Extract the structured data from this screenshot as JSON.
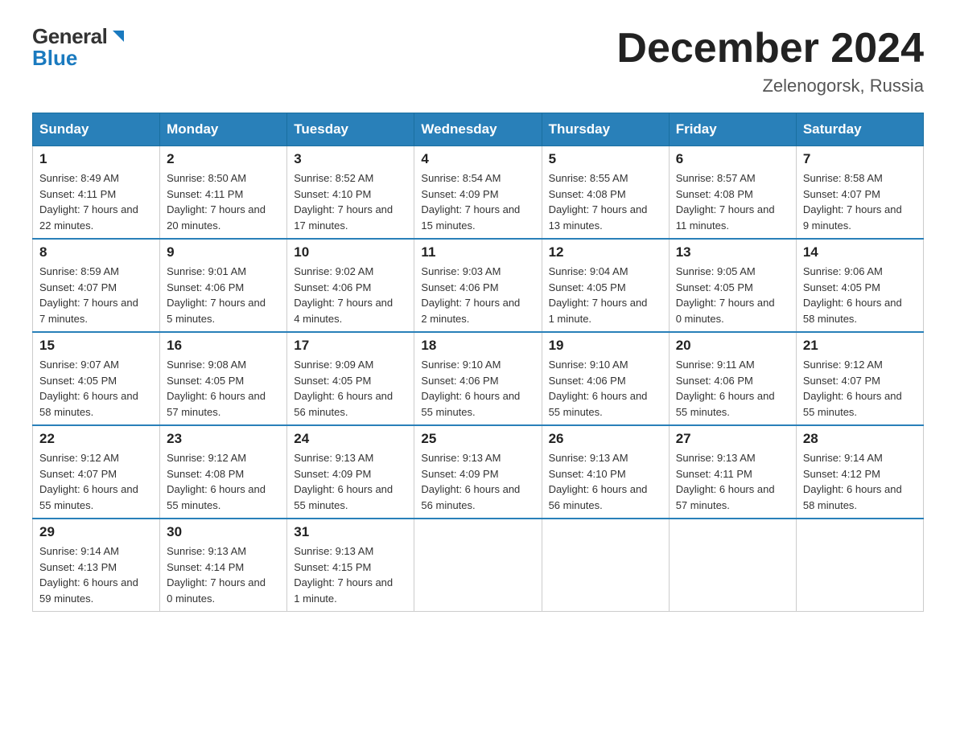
{
  "header": {
    "logo_general": "General",
    "logo_blue": "Blue",
    "title": "December 2024",
    "location": "Zelenogorsk, Russia"
  },
  "days_of_week": [
    "Sunday",
    "Monday",
    "Tuesday",
    "Wednesday",
    "Thursday",
    "Friday",
    "Saturday"
  ],
  "weeks": [
    {
      "days": [
        {
          "number": "1",
          "sunrise": "8:49 AM",
          "sunset": "4:11 PM",
          "daylight": "7 hours and 22 minutes."
        },
        {
          "number": "2",
          "sunrise": "8:50 AM",
          "sunset": "4:11 PM",
          "daylight": "7 hours and 20 minutes."
        },
        {
          "number": "3",
          "sunrise": "8:52 AM",
          "sunset": "4:10 PM",
          "daylight": "7 hours and 17 minutes."
        },
        {
          "number": "4",
          "sunrise": "8:54 AM",
          "sunset": "4:09 PM",
          "daylight": "7 hours and 15 minutes."
        },
        {
          "number": "5",
          "sunrise": "8:55 AM",
          "sunset": "4:08 PM",
          "daylight": "7 hours and 13 minutes."
        },
        {
          "number": "6",
          "sunrise": "8:57 AM",
          "sunset": "4:08 PM",
          "daylight": "7 hours and 11 minutes."
        },
        {
          "number": "7",
          "sunrise": "8:58 AM",
          "sunset": "4:07 PM",
          "daylight": "7 hours and 9 minutes."
        }
      ]
    },
    {
      "days": [
        {
          "number": "8",
          "sunrise": "8:59 AM",
          "sunset": "4:07 PM",
          "daylight": "7 hours and 7 minutes."
        },
        {
          "number": "9",
          "sunrise": "9:01 AM",
          "sunset": "4:06 PM",
          "daylight": "7 hours and 5 minutes."
        },
        {
          "number": "10",
          "sunrise": "9:02 AM",
          "sunset": "4:06 PM",
          "daylight": "7 hours and 4 minutes."
        },
        {
          "number": "11",
          "sunrise": "9:03 AM",
          "sunset": "4:06 PM",
          "daylight": "7 hours and 2 minutes."
        },
        {
          "number": "12",
          "sunrise": "9:04 AM",
          "sunset": "4:05 PM",
          "daylight": "7 hours and 1 minute."
        },
        {
          "number": "13",
          "sunrise": "9:05 AM",
          "sunset": "4:05 PM",
          "daylight": "7 hours and 0 minutes."
        },
        {
          "number": "14",
          "sunrise": "9:06 AM",
          "sunset": "4:05 PM",
          "daylight": "6 hours and 58 minutes."
        }
      ]
    },
    {
      "days": [
        {
          "number": "15",
          "sunrise": "9:07 AM",
          "sunset": "4:05 PM",
          "daylight": "6 hours and 58 minutes."
        },
        {
          "number": "16",
          "sunrise": "9:08 AM",
          "sunset": "4:05 PM",
          "daylight": "6 hours and 57 minutes."
        },
        {
          "number": "17",
          "sunrise": "9:09 AM",
          "sunset": "4:05 PM",
          "daylight": "6 hours and 56 minutes."
        },
        {
          "number": "18",
          "sunrise": "9:10 AM",
          "sunset": "4:06 PM",
          "daylight": "6 hours and 55 minutes."
        },
        {
          "number": "19",
          "sunrise": "9:10 AM",
          "sunset": "4:06 PM",
          "daylight": "6 hours and 55 minutes."
        },
        {
          "number": "20",
          "sunrise": "9:11 AM",
          "sunset": "4:06 PM",
          "daylight": "6 hours and 55 minutes."
        },
        {
          "number": "21",
          "sunrise": "9:12 AM",
          "sunset": "4:07 PM",
          "daylight": "6 hours and 55 minutes."
        }
      ]
    },
    {
      "days": [
        {
          "number": "22",
          "sunrise": "9:12 AM",
          "sunset": "4:07 PM",
          "daylight": "6 hours and 55 minutes."
        },
        {
          "number": "23",
          "sunrise": "9:12 AM",
          "sunset": "4:08 PM",
          "daylight": "6 hours and 55 minutes."
        },
        {
          "number": "24",
          "sunrise": "9:13 AM",
          "sunset": "4:09 PM",
          "daylight": "6 hours and 55 minutes."
        },
        {
          "number": "25",
          "sunrise": "9:13 AM",
          "sunset": "4:09 PM",
          "daylight": "6 hours and 56 minutes."
        },
        {
          "number": "26",
          "sunrise": "9:13 AM",
          "sunset": "4:10 PM",
          "daylight": "6 hours and 56 minutes."
        },
        {
          "number": "27",
          "sunrise": "9:13 AM",
          "sunset": "4:11 PM",
          "daylight": "6 hours and 57 minutes."
        },
        {
          "number": "28",
          "sunrise": "9:14 AM",
          "sunset": "4:12 PM",
          "daylight": "6 hours and 58 minutes."
        }
      ]
    },
    {
      "days": [
        {
          "number": "29",
          "sunrise": "9:14 AM",
          "sunset": "4:13 PM",
          "daylight": "6 hours and 59 minutes."
        },
        {
          "number": "30",
          "sunrise": "9:13 AM",
          "sunset": "4:14 PM",
          "daylight": "7 hours and 0 minutes."
        },
        {
          "number": "31",
          "sunrise": "9:13 AM",
          "sunset": "4:15 PM",
          "daylight": "7 hours and 1 minute."
        },
        null,
        null,
        null,
        null
      ]
    }
  ],
  "labels": {
    "sunrise": "Sunrise:",
    "sunset": "Sunset:",
    "daylight": "Daylight:"
  }
}
